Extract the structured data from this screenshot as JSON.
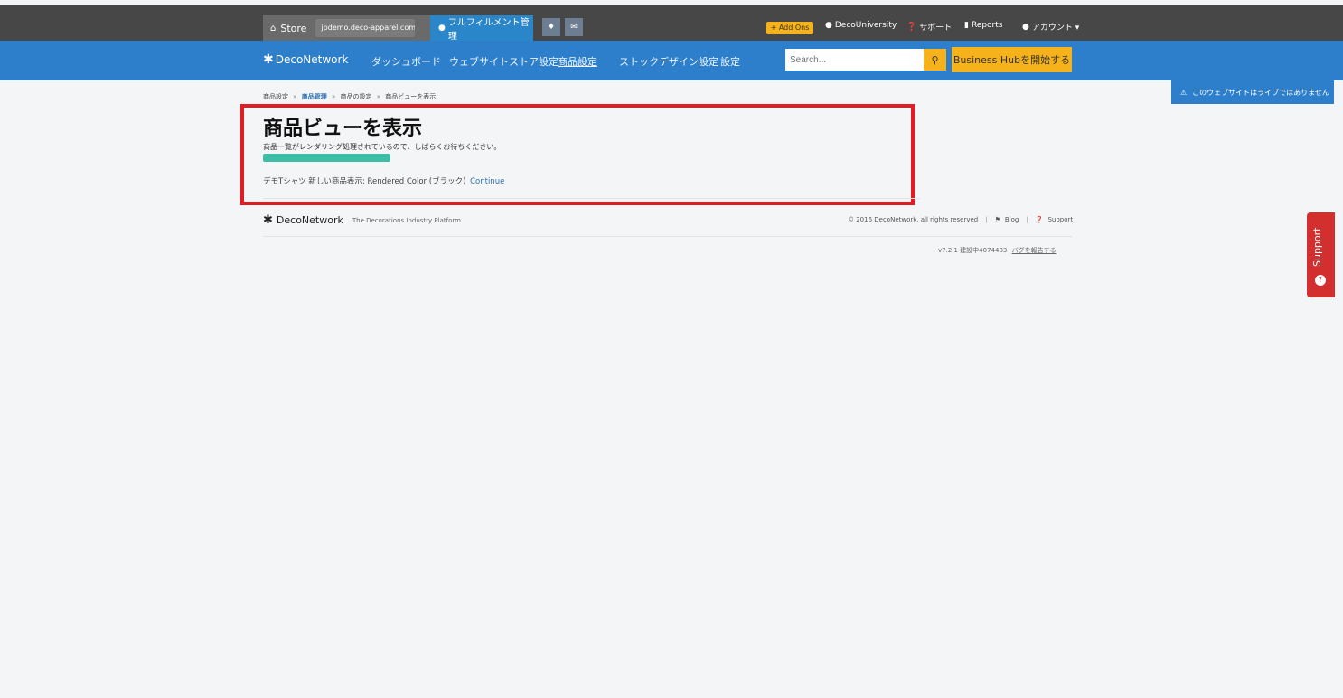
{
  "topbar": {
    "store_label": "Store",
    "store_domain": "jpdemo.deco-apparel.com",
    "fulfillment_label": "フルフィルメント管理",
    "addons_label": "+ Add Ons",
    "university_label": "DecoUniversity",
    "support_label": "サポート",
    "reports_label": "Reports",
    "account_label": "アカウント ▾"
  },
  "nav": {
    "brand": "DecoNetwork",
    "items": [
      "ダッシュボード",
      "ウェブサイトストア設定",
      "商品設定",
      "ストックデザイン設定",
      "設定"
    ],
    "active_index": 2,
    "search_placeholder": "Search...",
    "hub_button": "Business Hubを開始する"
  },
  "notice": {
    "not_live": "このウェブサイトはライブではありません"
  },
  "breadcrumb": {
    "items": [
      "商品設定",
      "商品管理",
      "商品の設定",
      "商品ビューを表示"
    ],
    "separator": "»",
    "link_index": 1
  },
  "main": {
    "title": "商品ビューを表示",
    "render_message": "商品一覧がレンダリング処理されているので、しばらくお待ちください。",
    "progress": 1.0,
    "product_text": "デモTシャツ 新しい商品表示: Rendered Color (ブラック)",
    "continue_label": "Continue"
  },
  "footer": {
    "brand": "DecoNetwork",
    "tagline": "The Decorations Industry Platform",
    "copyright": "© 2016 DecoNetwork, all rights reserved",
    "blog_label": "Blog",
    "support_label": "Support",
    "version_text": "v7.2.1 建設中4074483",
    "bug_label": "バグを報告する"
  },
  "support_tab": {
    "label": "Support"
  },
  "colors": {
    "topbar": "#474747",
    "navbar": "#2d7fcc",
    "accent_yellow": "#f6b21b",
    "highlight_red": "#e11d23",
    "progress_fill": "#3cbfa6"
  }
}
